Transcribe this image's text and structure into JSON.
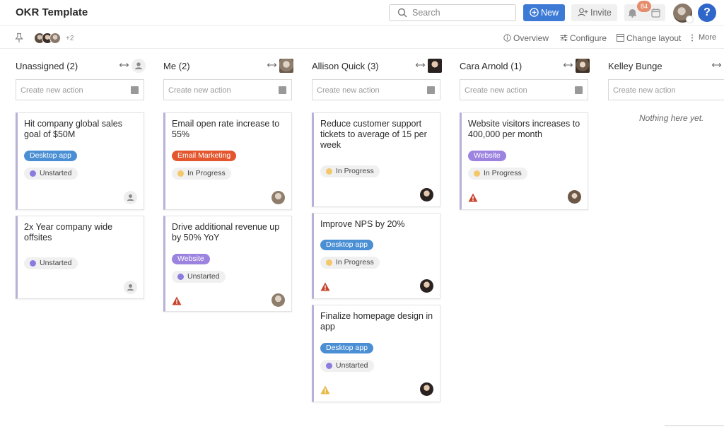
{
  "app": {
    "title": "OKR Template"
  },
  "header": {
    "search_placeholder": "Search",
    "new_label": "New",
    "invite_label": "Invite",
    "notification_count": "84",
    "help_label": "?"
  },
  "subbar": {
    "more_members": "+2",
    "overview_label": "Overview",
    "configure_label": "Configure",
    "change_layout_label": "Change layout",
    "more_label": "More"
  },
  "colors": {
    "accent": "#3d7ad6",
    "tag_blue": "#4a8fd4",
    "tag_orange": "#e4572e",
    "tag_purple": "#9c83e0",
    "status_unstarted": "#8a7be0",
    "status_in_progress": "#f2c86a",
    "warning_red": "#c9442d",
    "warning_yellow": "#e8b844"
  },
  "create_placeholder": "Create new action",
  "columns": [
    {
      "name": "Unassigned (2)",
      "cards": [
        {
          "title": "Hit company global sales goal of $50M",
          "tag": "Desktop app",
          "status": "Unstarted"
        },
        {
          "title": "2x Year company wide offsites",
          "status": "Unstarted"
        }
      ]
    },
    {
      "name": "Me (2)",
      "cards": [
        {
          "title": "Email open rate increase to 55%",
          "tag": "Email Marketing",
          "status": "In Progress"
        },
        {
          "title": "Drive additional revenue up by 50% YoY",
          "tag": "Website",
          "status": "Unstarted"
        }
      ]
    },
    {
      "name": "Allison Quick (3)",
      "cards": [
        {
          "title": "Reduce customer support tickets to average of 15 per week",
          "status": "In Progress"
        },
        {
          "title": "Improve NPS by 20%",
          "tag": "Desktop app",
          "status": "In Progress"
        },
        {
          "title": "Finalize homepage design in app",
          "tag": "Desktop app",
          "status": "Unstarted"
        }
      ]
    },
    {
      "name": "Cara Arnold (1)",
      "cards": [
        {
          "title": "Website visitors increases to 400,000 per month",
          "tag": "Website",
          "status": "In Progress"
        }
      ]
    },
    {
      "name": "Kelley Bunge",
      "empty_text": "Nothing here yet."
    }
  ]
}
